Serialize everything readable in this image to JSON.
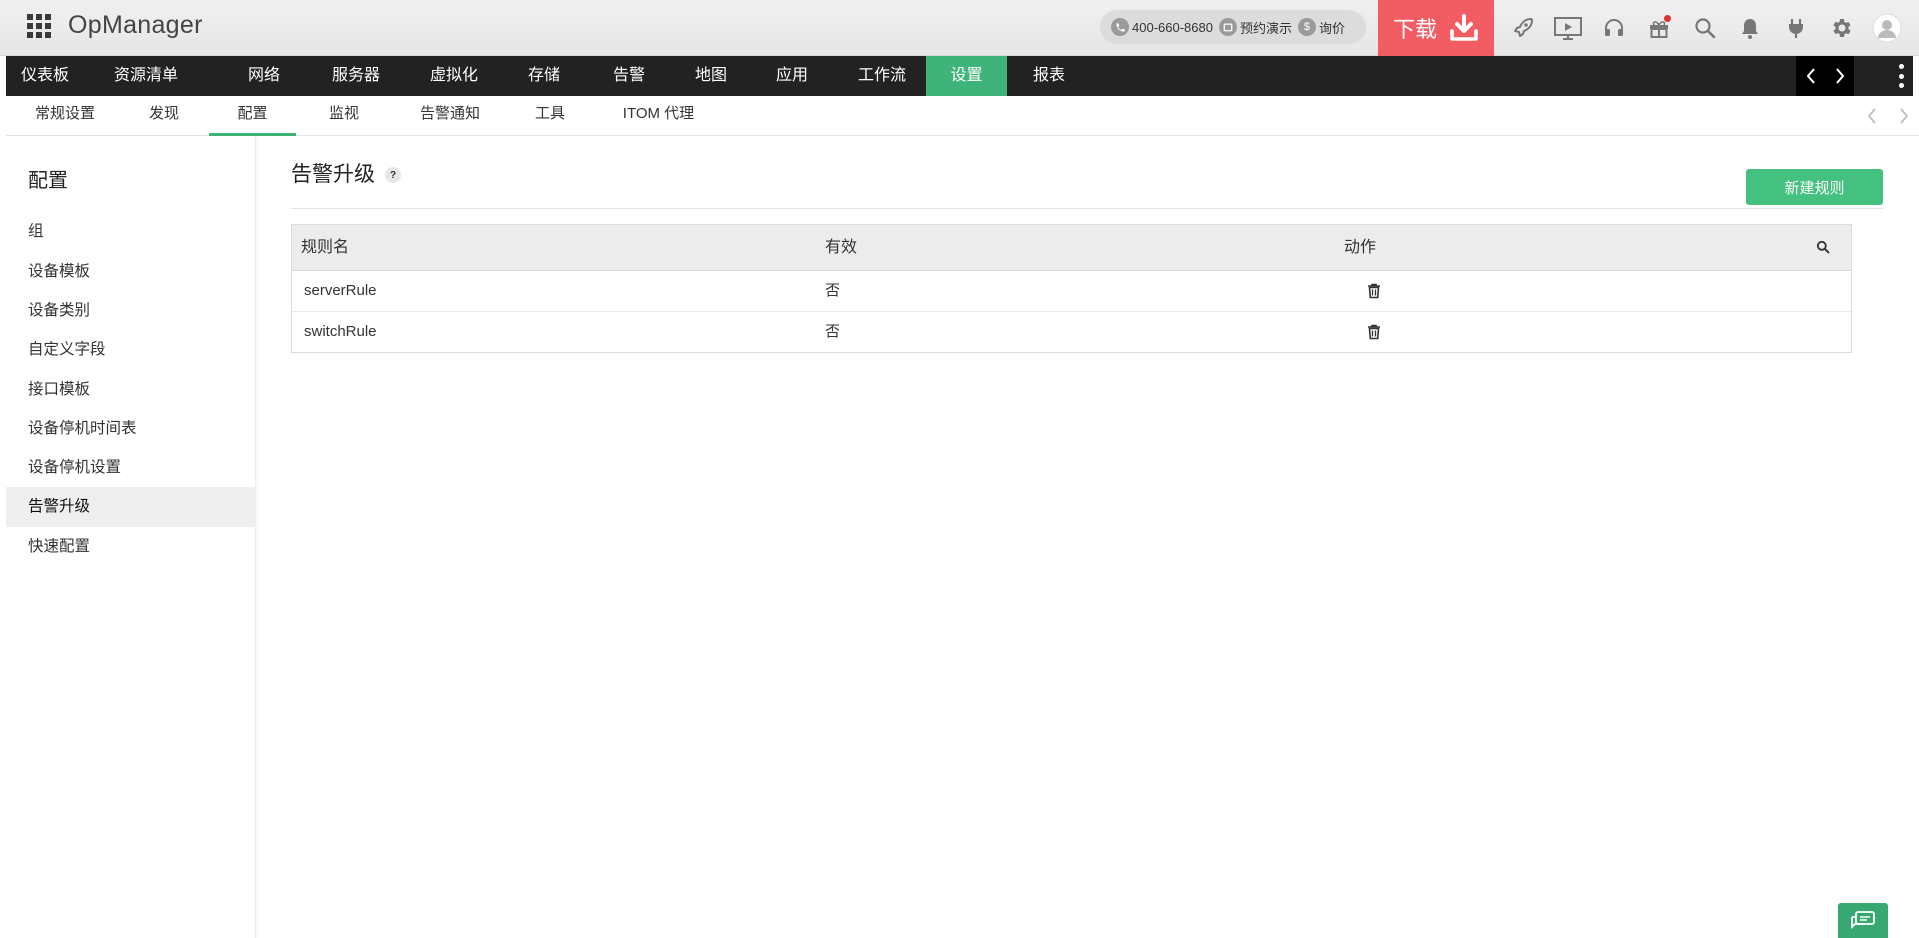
{
  "app": {
    "brand": "OpManager"
  },
  "header": {
    "phone": "400-660-8680",
    "demo_label": "预约演示",
    "quote_label": "询价",
    "download_label": "下载",
    "icons": [
      "rocket-icon",
      "presentation-icon",
      "headset-icon",
      "gift-icon",
      "search-icon",
      "bell-icon",
      "plug-icon",
      "gear-icon",
      "user-avatar-icon"
    ],
    "accent_download": "#f25d63"
  },
  "mainnav": {
    "items": [
      {
        "label": "仪表板"
      },
      {
        "label": "资源清单"
      },
      {
        "label": "网络"
      },
      {
        "label": "服务器"
      },
      {
        "label": "虚拟化"
      },
      {
        "label": "存储"
      },
      {
        "label": "告警"
      },
      {
        "label": "地图"
      },
      {
        "label": "应用"
      },
      {
        "label": "工作流"
      },
      {
        "label": "设置"
      },
      {
        "label": "报表"
      }
    ],
    "active": "设置",
    "active_color": "#3fb47a"
  },
  "subnav": {
    "items": [
      {
        "label": "常规设置"
      },
      {
        "label": "发现"
      },
      {
        "label": "配置"
      },
      {
        "label": "监视"
      },
      {
        "label": "告警通知"
      },
      {
        "label": "工具"
      },
      {
        "label": "ITOM 代理"
      }
    ],
    "active": "配置"
  },
  "sidebar": {
    "title": "配置",
    "items": [
      {
        "label": "组"
      },
      {
        "label": "设备模板"
      },
      {
        "label": "设备类别"
      },
      {
        "label": "自定义字段"
      },
      {
        "label": "接口模板"
      },
      {
        "label": "设备停机时间表"
      },
      {
        "label": "设备停机设置"
      },
      {
        "label": "告警升级"
      },
      {
        "label": "快速配置"
      }
    ],
    "active": "告警升级"
  },
  "main": {
    "title": "告警升级",
    "help": "?",
    "new_button": "新建规则",
    "table": {
      "columns": [
        "规则名",
        "有效",
        "动作"
      ],
      "rows": [
        {
          "name": "serverRule",
          "enabled": "否"
        },
        {
          "name": "switchRule",
          "enabled": "否"
        }
      ]
    }
  }
}
